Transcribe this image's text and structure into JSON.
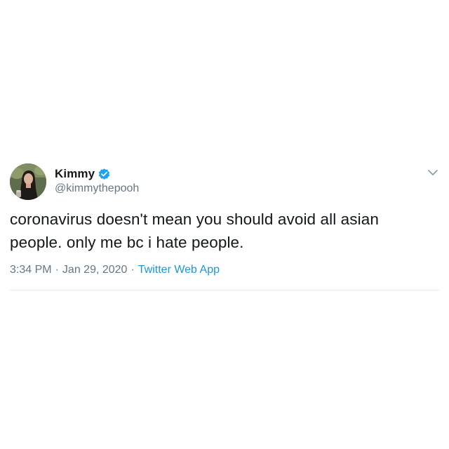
{
  "user": {
    "display_name": "Kimmy",
    "handle": "@kimmythepooh",
    "verified": true
  },
  "tweet": {
    "text_line_1": "coronavirus doesn't mean you should avoid all asian",
    "text_line_2": "people. only me bc i hate people."
  },
  "meta": {
    "time": "3:34 PM",
    "separator_1": "·",
    "date": "Jan 29, 2020",
    "separator_2": "·",
    "source": "Twitter Web App"
  },
  "icons": {
    "verified": "verified-badge-icon",
    "more": "chevron-down-icon",
    "avatar": "profile-photo"
  },
  "colors": {
    "text": "#14171a",
    "secondary": "#657786",
    "link": "#1b95e0",
    "verified": "#1da1f2",
    "divider": "#e6ecf0"
  }
}
